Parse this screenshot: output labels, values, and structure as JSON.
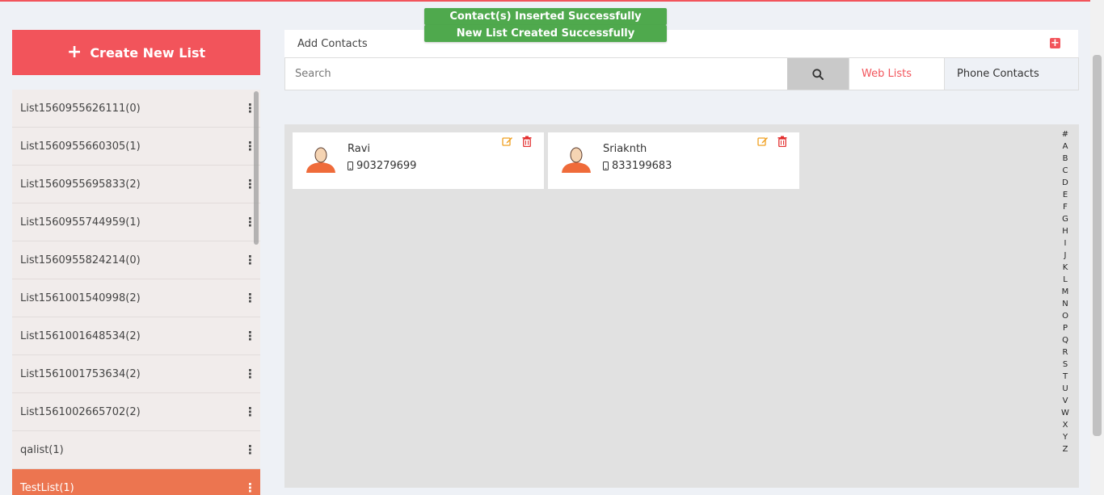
{
  "toasts": [
    "Contact(s) Inserted Successfully",
    "New List Created Successfully"
  ],
  "sidebar": {
    "create_label": "Create New List",
    "lists": [
      {
        "label": "List1560955626111(0)"
      },
      {
        "label": "List1560955660305(1)"
      },
      {
        "label": "List1560955695833(2)"
      },
      {
        "label": "List1560955744959(1)"
      },
      {
        "label": "List1560955824214(0)"
      },
      {
        "label": "List1561001540998(2)"
      },
      {
        "label": "List1561001648534(2)"
      },
      {
        "label": "List1561001753634(2)"
      },
      {
        "label": "List1561002665702(2)"
      },
      {
        "label": "qalist(1)"
      },
      {
        "label": "TestList(1)",
        "active": true
      }
    ]
  },
  "main": {
    "header_title": "Add Contacts",
    "search_placeholder": "Search",
    "tabs": [
      {
        "label": "Web Lists",
        "active": true
      },
      {
        "label": "Phone Contacts"
      }
    ],
    "contacts": [
      {
        "name": "Ravi",
        "phone": "903279699"
      },
      {
        "name": "Sriaknth",
        "phone": "833199683"
      }
    ],
    "alphabet": [
      "#",
      "A",
      "B",
      "C",
      "D",
      "E",
      "F",
      "G",
      "H",
      "I",
      "J",
      "K",
      "L",
      "M",
      "N",
      "O",
      "P",
      "Q",
      "R",
      "S",
      "T",
      "U",
      "V",
      "W",
      "X",
      "Y",
      "Z"
    ]
  },
  "colors": {
    "accent": "#f2545b",
    "active_list": "#ec7550",
    "toast": "#4fa94d",
    "edit_icon": "#f0a020",
    "delete_icon": "#e33030"
  },
  "icons": [
    "plus-icon",
    "kebab-menu-icon",
    "add-square-icon",
    "search-icon",
    "edit-icon",
    "trash-icon",
    "avatar-icon",
    "mobile-phone-icon"
  ]
}
